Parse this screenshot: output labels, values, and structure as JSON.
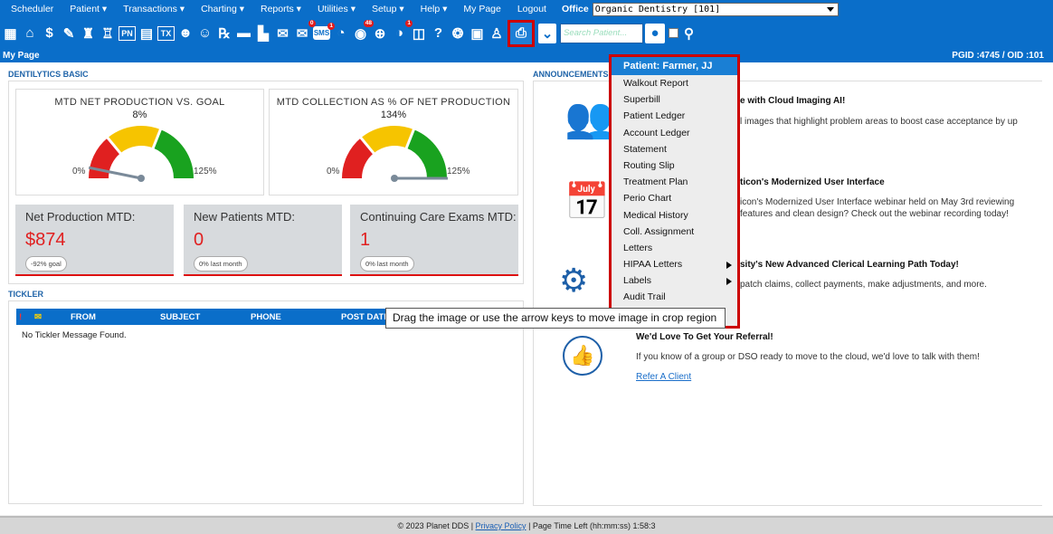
{
  "menu": {
    "items": [
      "Scheduler",
      "Patient ▾",
      "Transactions ▾",
      "Charting ▾",
      "Reports ▾",
      "Utilities ▾",
      "Setup ▾",
      "Help ▾",
      "My Page",
      "Logout"
    ],
    "office_label": "Office",
    "office_value": "Organic Dentistry [101]"
  },
  "toolbar": {
    "badges": {
      "letters": "0",
      "sms": "1",
      "globe": "48",
      "ins": "1"
    },
    "search_placeholder": "Search Patient..."
  },
  "subbar": {
    "page": "My Page",
    "ids": "PGID :4745 / OID :101"
  },
  "dentilytics": {
    "title": "DENTILYTICS BASIC",
    "gauges": [
      {
        "title": "MTD NET PRODUCTION VS. GOAL",
        "pct": "8%",
        "min": "0%",
        "max": "125%",
        "value": 8
      },
      {
        "title": "MTD COLLECTION AS % OF NET PRODUCTION",
        "pct": "134%",
        "min": "0%",
        "max": "125%",
        "value": 134
      }
    ],
    "stats": [
      {
        "label": "Net Production MTD:",
        "value": "$874",
        "pill": "-92% goal"
      },
      {
        "label": "New Patients MTD:",
        "value": "0",
        "pill": "0% last month"
      },
      {
        "label": "Continuing Care Exams MTD:",
        "value": "1",
        "pill": "0% last month"
      }
    ]
  },
  "tickler": {
    "title": "TICKLER",
    "flag": "!",
    "columns": [
      "FROM",
      "SUBJECT",
      "PHONE",
      "POST DATE"
    ],
    "empty": "No Tickler Message Found."
  },
  "announcements": {
    "title": "ANNOUNCEMENTS",
    "items": [
      {
        "heading": "e with Cloud Imaging AI!",
        "text": "l images that highlight problem areas to boost case acceptance by up"
      },
      {
        "heading": "ticon's Modernized User Interface",
        "text": "icon's Modernized User Interface webinar held on May 3rd reviewing",
        "text2": "features and clean design? Check out the webinar recording today!"
      },
      {
        "heading": "sity's New Advanced Clerical Learning Path Today!",
        "text": "patch claims, collect payments, make adjustments, and more."
      },
      {
        "heading": "We'd Love To Get Your Referral!",
        "text": "If you know of a group or DSO ready to move to the cloud, we'd love to talk with them!",
        "link": "Refer A Client"
      }
    ]
  },
  "dropdown": {
    "header": "Patient: Farmer, JJ",
    "items": [
      "Walkout Report",
      "Superbill",
      "Patient Ledger",
      "Account Ledger",
      "Statement",
      "Routing Slip",
      "Treatment Plan",
      "Perio Chart",
      "Medical History",
      "Coll. Assignment",
      "Letters",
      "HIPAA Letters",
      "Labels",
      "Audit Trail"
    ],
    "submenu_items": [
      "HIPAA Letters",
      "Labels"
    ]
  },
  "tooltip": "Drag the image or use the arrow keys to move image in crop region",
  "footer": {
    "copyright": "© 2023 Planet DDS |",
    "privacy": "Privacy Policy",
    "time": "| Page Time Left (hh:mm:ss) 1:58:3"
  }
}
